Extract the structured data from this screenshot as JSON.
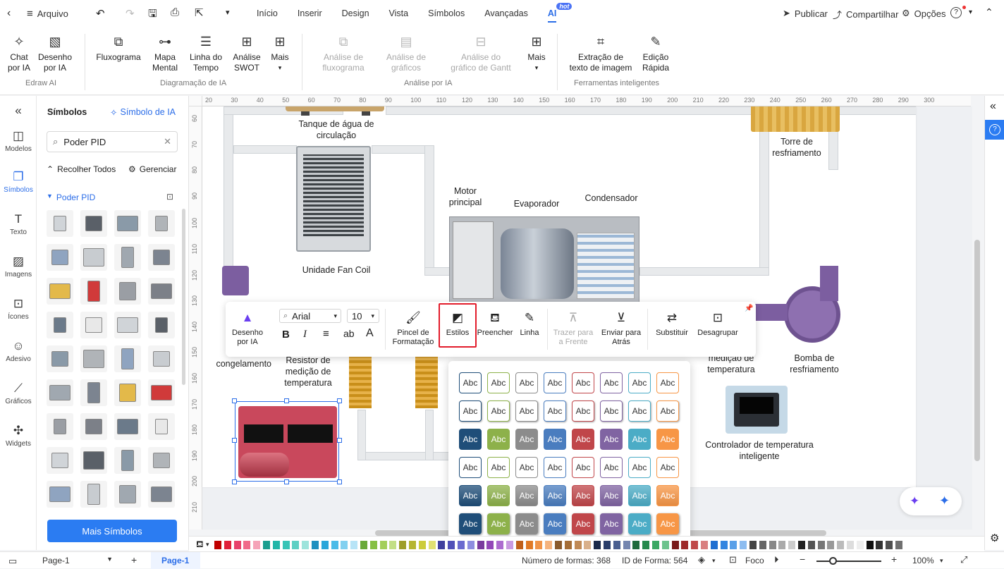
{
  "menubar": {
    "file_label": "Arquivo",
    "tabs": [
      "Início",
      "Inserir",
      "Design",
      "Vista",
      "Símbolos",
      "Avançadas",
      "AI"
    ],
    "hot_badge": "hot",
    "publish": "Publicar",
    "share": "Compartilhar",
    "options": "Opções",
    "help": "?"
  },
  "ribbon": {
    "chat": "Chat\npor IA",
    "ai_drawing": "Desenho\npor IA",
    "group_edraw": "Edraw AI",
    "flowchart": "Fluxograma",
    "mindmap": "Mapa\nMental",
    "timeline": "Linha do\nTempo",
    "swot": "Análise\nSWOT",
    "more1": "Mais",
    "group_diagram": "Diagramação de IA",
    "flow_analysis": "Análise de\nfluxograma",
    "chart_analysis": "Análise de\ngráficos",
    "gantt_analysis": "Análise do\ngráfico de Gantt",
    "more2": "Mais",
    "group_analysis": "Análise por IA",
    "ocr": "Extração de\ntexto de imagem",
    "quick_edit": "Edição\nRápida",
    "group_tools": "Ferramentas inteligentes"
  },
  "leftbar": {
    "models": "Modelos",
    "symbols": "Símbolos",
    "text": "Texto",
    "images": "Imagens",
    "icons": "Ícones",
    "sticker": "Adesivo",
    "charts": "Gráficos",
    "widgets": "Widgets"
  },
  "sympanel": {
    "title": "Símbolos",
    "ai_symbol": "Símbolo de IA",
    "search_value": "Poder PID",
    "collapse_all": "Recolher Todos",
    "manage": "Gerenciar",
    "library": "Poder PID",
    "more_symbols": "Mais Símbolos"
  },
  "ruler": {
    "top": [
      "20",
      "30",
      "40",
      "50",
      "60",
      "70",
      "80",
      "90",
      "100",
      "110",
      "120",
      "130",
      "140",
      "150",
      "160",
      "170",
      "180",
      "190",
      "200",
      "210",
      "220",
      "230",
      "240",
      "250",
      "260",
      "270",
      "280",
      "290",
      "300"
    ],
    "left": [
      "60",
      "70",
      "80",
      "90",
      "100",
      "110",
      "120",
      "130",
      "140",
      "150",
      "160",
      "170",
      "180",
      "190",
      "200",
      "210"
    ]
  },
  "diagram": {
    "tank": "Tanque de água de\ncirculação",
    "cooling_tower": "Torre de\nresfriamento",
    "main_motor": "Motor\nprincipal",
    "evaporator": "Evaporador",
    "condenser": "Condensador",
    "fan_coil": "Unidade Fan Coil",
    "freeze_pump": "Bo\ncongelamento",
    "resistor": "Resistor de\nmedição de\ntemperatura",
    "temp_measure": "medição de\ntemperatura",
    "cooling_pump": "Bomba de\nresfriamento",
    "controller": "Controlador de temperatura\ninteligente"
  },
  "floating_toolbar": {
    "ai_drawing": "Desenho\npor IA",
    "font": "Arial",
    "size": "10",
    "format_painter": "Pincel de\nFormatação",
    "styles": "Estilos",
    "fill": "Preencher",
    "line": "Linha",
    "bring_front": "Trazer para\na Frente",
    "send_back": "Enviar para\nAtrás",
    "replace": "Substituir",
    "ungroup": "Desagrupar",
    "bold": "B",
    "italic": "I",
    "ab": "ab",
    "font_color": "A"
  },
  "style_popup": {
    "swatch_text": "Abc",
    "colors": [
      "#1f4e79",
      "#8db14a",
      "#8c8c8c",
      "#4a7dbf",
      "#c0464a",
      "#8064a2",
      "#4bacc6",
      "#f79646"
    ]
  },
  "status": {
    "page_select": "Page-1",
    "page_tab": "Page-1",
    "shape_count": "Número de formas: 368",
    "shape_id": "ID de Forma: 564",
    "focus": "Foco",
    "zoom": "100%"
  },
  "palette": [
    "#c00000",
    "#e0203a",
    "#e8406a",
    "#f06a8a",
    "#f5a3b8",
    "#1a9e8f",
    "#21b6a8",
    "#36c4b6",
    "#5dd0c4",
    "#9de4dc",
    "#1e8fc0",
    "#2aa6da",
    "#4bbbe8",
    "#82d0f0",
    "#b7e4f7",
    "#6aa93a",
    "#86c043",
    "#a3cf5a",
    "#c3df86",
    "#9e9e2a",
    "#b5b531",
    "#cccc3b",
    "#e0e073",
    "#3f3f9e",
    "#5050b8",
    "#6b6bcf",
    "#8e8ee0",
    "#7a3b9e",
    "#9348b8",
    "#ad6ccf",
    "#c99ae0",
    "#c0601a",
    "#e07a26",
    "#f09448",
    "#f5b37d",
    "#8a5a2b",
    "#a56e37",
    "#c08a56",
    "#d9b08a",
    "#1b2a4a",
    "#2b3f6b",
    "#4a5f8f",
    "#7486b0",
    "#1e6b3c",
    "#268a4d",
    "#3aa863",
    "#6cc38d",
    "#7a1a1a",
    "#9e2a2a",
    "#c04a4a",
    "#d98080",
    "#1f6fd1",
    "#3385e0",
    "#5aa0e8",
    "#8cbcf0",
    "#444",
    "#666",
    "#888",
    "#aaa",
    "#ccc",
    "#222",
    "#555",
    "#777",
    "#999",
    "#bbb",
    "#ddd",
    "#eee",
    "#101010",
    "#333",
    "#505050",
    "#707070"
  ]
}
